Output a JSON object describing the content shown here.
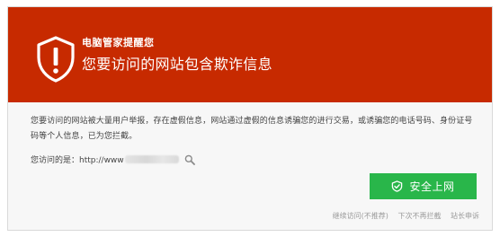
{
  "banner": {
    "brand": "电脑管家提醒您",
    "headline": "您要访问的网站包含欺诈信息",
    "icon": "shield-warning-icon",
    "color": "#c72a00"
  },
  "body": {
    "description": "您要访问的网站被大量用户举报，存在虚假信息，网站通过虚假的信息诱骗您的进行交易，或诱骗您的电话号码、身份证号码等个人信息，已为您拦截。",
    "url_label": "您访问的是：http://www",
    "search_icon": "magnifier-icon"
  },
  "actions": {
    "safe_button_label": "安全上网",
    "safe_button_icon": "shield-check-icon",
    "safe_button_color": "#29b64a",
    "continue_label": "继续访问(不推荐)",
    "no_block_label": "下次不再拦截",
    "appeal_label": "站长申诉"
  }
}
